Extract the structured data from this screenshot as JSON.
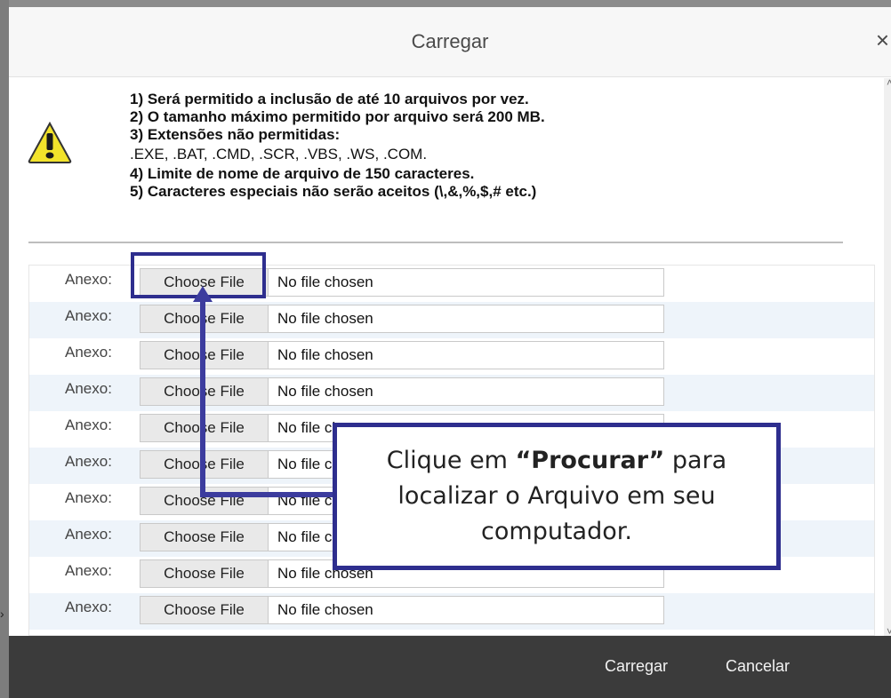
{
  "dialog": {
    "title": "Carregar",
    "close_icon": "×"
  },
  "rules": {
    "line1": "1) Será permitido a inclusão de até 10 arquivos por vez.",
    "line2": "2) O tamanho máximo permitido por arquivo será 200 MB.",
    "line3": "3) Extensões não permitidas:",
    "line3b": ".EXE, .BAT, .CMD, .SCR, .VBS, .WS, .COM.",
    "line4": "4) Limite de nome de arquivo de 150 caracteres.",
    "line5": "5) Caracteres especiais não serão aceitos (\\,&,%,$,# etc.)"
  },
  "attachments": {
    "label": "Anexo:",
    "button_label": "Choose File",
    "status": "No file chosen",
    "count": 10
  },
  "callout": {
    "pre": "Clique em ",
    "bold": "“Procurar”",
    "post": " para localizar o Arquivo em seu computador."
  },
  "footer": {
    "upload_label": "Carregar",
    "cancel_label": "Cancelar"
  },
  "colors": {
    "highlight": "#2e2e8e",
    "footer_bg": "#3b3b3b",
    "row_alt": "#eef4fa"
  },
  "icons": {
    "warning": "warning-icon",
    "close": "close-icon"
  }
}
